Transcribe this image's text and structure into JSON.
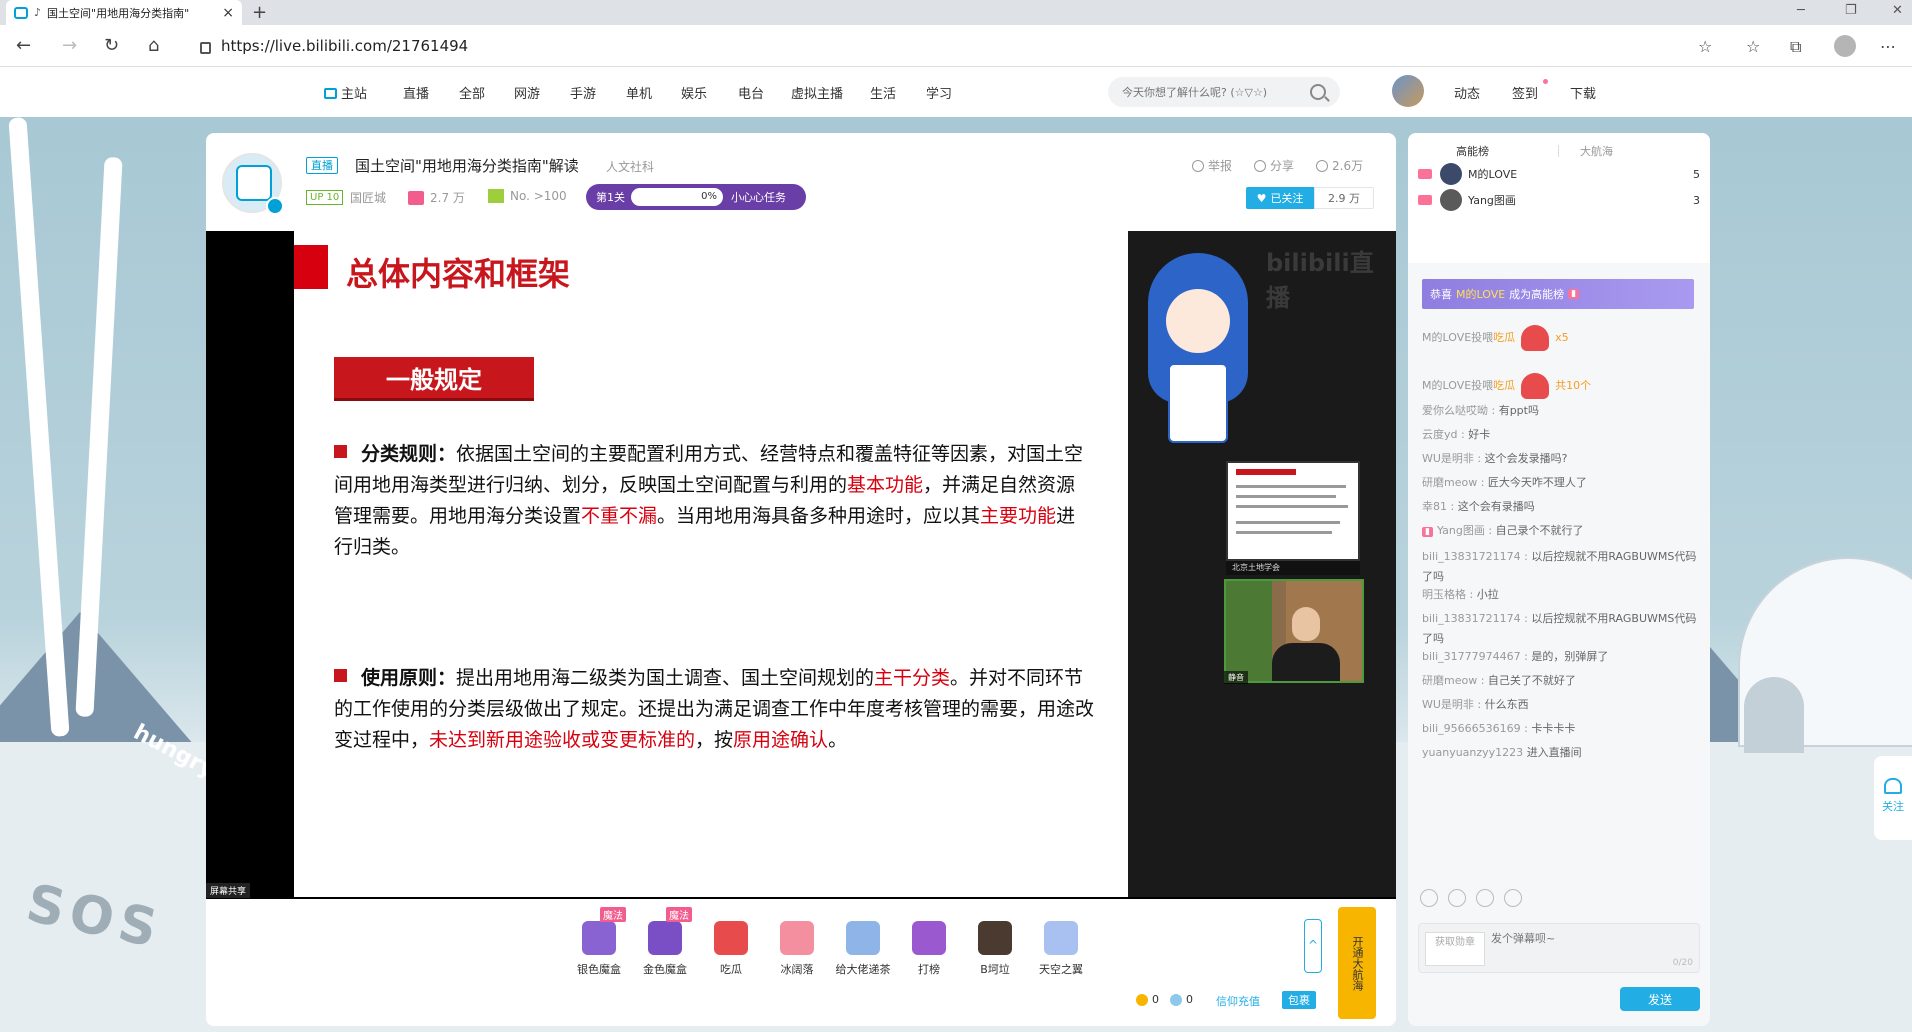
{
  "browser": {
    "tab_title": "国土空间\"用地用海分类指南\"",
    "url": "https://live.bilibili.com/21761494"
  },
  "sitenav": {
    "items": [
      "主站",
      "直播",
      "全部",
      "网游",
      "手游",
      "单机",
      "娱乐",
      "电台",
      "虚拟主播",
      "生活",
      "学习"
    ],
    "search_placeholder": "今天你想了解什么呢? (☆▽☆)",
    "right": [
      "动态",
      "签到",
      "下载"
    ]
  },
  "room": {
    "live_tag": "直播",
    "title": "国土空间\"用地用海分类指南\"解读",
    "category": "人文社科",
    "report": "举报",
    "share": "分享",
    "viewers": "2.6万",
    "up_level": "UP 10",
    "area": "国匠城",
    "gift_count": "2.7 万",
    "rank": "No. >100",
    "task_level": "第1关",
    "task_progress": "0%",
    "task_name": "小心心任务",
    "follow_label": "已关注",
    "followers": "2.9 万"
  },
  "slide": {
    "title": "总体内容和框架",
    "box": "一般规定",
    "p1_head": "分类规则：",
    "p1_a": "依据国土空间的主要配置利用方式、经营特点和覆盖特征等因素，对国土空间用地用海类型进行归纳、划分，反映国土空间配置与利用的",
    "p1_r1": "基本功能",
    "p1_b": "，并满足自然资源管理需要。用地用海分类设置",
    "p1_r2": "不重不漏",
    "p1_c": "。当用地用海具备多种用途时，应以其",
    "p1_r3": "主要功能",
    "p1_d": "进行归类。",
    "p2_head": "使用原则：",
    "p2_a": "提出用地用海二级类为国土调查、国土空间规划的",
    "p2_r1": "主干分类",
    "p2_b": "。并对不同环节的工作使用的分类层级做出了规定。还提出为满足调查工作中年度考核管理的需要，用途改变过程中，",
    "p2_r2": "未达到新用途验收或变更标准的",
    "p2_c": "，按",
    "p2_r3": "原用途确认",
    "p2_d": "。",
    "watermark": "bilibili直播",
    "pip1_label": "北京土地学会",
    "pip2_label": "静音",
    "share_label": "屏幕共享"
  },
  "gifts": [
    {
      "name": "银色魔盒",
      "badge": "魔法",
      "color": "#8a63d2"
    },
    {
      "name": "金色魔盒",
      "badge": "魔法",
      "color": "#7a4fc6"
    },
    {
      "name": "吃瓜",
      "badge": "",
      "color": "#e84b4b"
    },
    {
      "name": "冰阔落",
      "badge": "",
      "color": "#f48fa0"
    },
    {
      "name": "给大佬递茶",
      "badge": "",
      "color": "#8fb4e8"
    },
    {
      "name": "打榜",
      "badge": "",
      "color": "#9b59d0"
    },
    {
      "name": "B坷垃",
      "badge": "",
      "color": "#4a3a30"
    },
    {
      "name": "天空之翼",
      "badge": "",
      "color": "#a9c1f0"
    }
  ],
  "wallet": {
    "gold": "0",
    "silver": "0",
    "recharge": "信仰充值",
    "bag": "包裹",
    "guard_banner": "开通大航海"
  },
  "sidebar": {
    "tab_active": "高能榜",
    "tab_inactive": "大航海",
    "ranks": [
      {
        "name": "M的LOVE",
        "value": "5"
      },
      {
        "name": "Yang图画",
        "value": "3"
      }
    ],
    "congrats_pre": "恭喜",
    "congrats_user": "M的LOVE",
    "congrats_post": "成为高能榜",
    "messages": [
      {
        "user": "M的LOVE",
        "sep": "投喂",
        "text": "吃瓜",
        "extra": "x5",
        "type": "gift"
      },
      {
        "user": "M的LOVE",
        "sep": "投喂",
        "text": "吃瓜",
        "extra": "共10个",
        "type": "gift"
      },
      {
        "user": "爱你么哒哎呦",
        "sep": " : ",
        "text": "有ppt吗",
        "type": "chat"
      },
      {
        "user": "云度yd",
        "sep": " : ",
        "text": "好卡",
        "type": "chat"
      },
      {
        "user": "WU是明非",
        "sep": " : ",
        "text": "这个会发录播吗?",
        "type": "chat"
      },
      {
        "user": "研磨meow",
        "sep": " : ",
        "text": "匠大今天咋不理人了",
        "type": "chat"
      },
      {
        "user": "幸81",
        "sep": " : ",
        "text": "这个会有录播吗",
        "type": "chat"
      },
      {
        "user": "Yang图画",
        "sep": " : ",
        "text": "自己录个不就行了",
        "type": "chat"
      },
      {
        "user": "bili_13831721174",
        "sep": " : ",
        "text": "以后控规就不用RAGBUWMS代码了吗",
        "type": "chat"
      },
      {
        "user": "明玉格格",
        "sep": " : ",
        "text": "小拉",
        "type": "chat"
      },
      {
        "user": "bili_13831721174",
        "sep": " : ",
        "text": "以后控规就不用RAGBUWMS代码了吗",
        "type": "chat"
      },
      {
        "user": "bili_31777974467",
        "sep": " : ",
        "text": "是的，别弹屏了",
        "type": "chat"
      },
      {
        "user": "研磨meow",
        "sep": " : ",
        "text": "自己关了不就好了",
        "type": "chat"
      },
      {
        "user": "WU是明非",
        "sep": " : ",
        "text": "什么东西",
        "type": "chat"
      },
      {
        "user": "bili_95666536169",
        "sep": " : ",
        "text": "卡卡卡卡",
        "type": "chat"
      },
      {
        "user": "yuanyuanzyy1223",
        "sep": " ",
        "text": "进入直播间",
        "type": "enter"
      }
    ],
    "medal_btn": "获取勋章",
    "input_placeholder": "发个弹幕呗~",
    "input_count": "0/20",
    "send": "发送",
    "follow_side": "关注"
  },
  "scene": {
    "sos": "SOS",
    "hungry": "hungry"
  }
}
